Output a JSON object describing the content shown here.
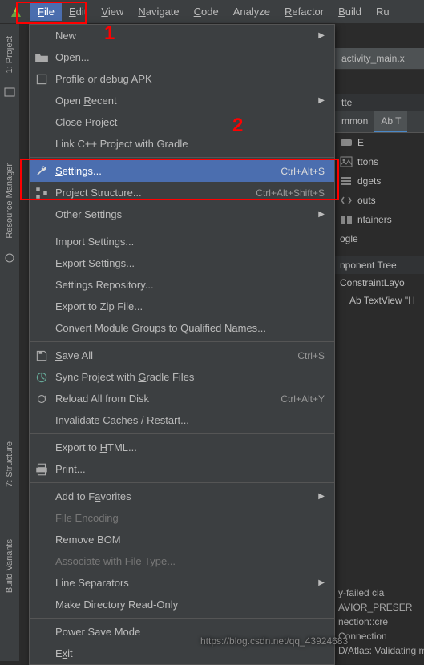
{
  "menubar": {
    "items": [
      {
        "label": "File",
        "mn": "F",
        "rest": "ile"
      },
      {
        "label": "Edit",
        "mn": "E",
        "rest": "dit"
      },
      {
        "label": "View",
        "mn": "V",
        "rest": "iew"
      },
      {
        "label": "Navigate",
        "mn": "N",
        "rest": "avigate"
      },
      {
        "label": "Code",
        "mn": "C",
        "rest": "ode"
      },
      {
        "label": "Analyze",
        "mn": "",
        "rest": "Analyze"
      },
      {
        "label": "Refactor",
        "mn": "R",
        "rest": "efactor"
      },
      {
        "label": "Build",
        "mn": "B",
        "rest": "uild"
      },
      {
        "label": "Run",
        "mn": "",
        "rest": "Ru"
      }
    ]
  },
  "annotations": {
    "one": "1",
    "two": "2"
  },
  "menu": {
    "new": "New",
    "open": "Open...",
    "profile": "Profile or debug APK",
    "open_recent_pre": "Open ",
    "open_recent_mn": "R",
    "open_recent_post": "ecent",
    "close_project_pre": "Close Pro",
    "close_project_mn": "j",
    "close_project_post": "ect",
    "link_cpp": "Link C++ Project with Gradle",
    "settings_mn": "S",
    "settings_post": "ettings...",
    "settings_sc": "Ctrl+Alt+S",
    "proj_struct": "Project Structure...",
    "proj_struct_sc": "Ctrl+Alt+Shift+S",
    "other_settings": "Other Settings",
    "import_settings": "Import Settings...",
    "export_settings_mn": "E",
    "export_settings_post": "xport Settings...",
    "settings_repo": "Settings Repository...",
    "export_zip": "Export to Zip File...",
    "convert_groups": "Convert Module Groups to Qualified Names...",
    "save_all_mn": "S",
    "save_all_post": "ave All",
    "save_all_sc": "Ctrl+S",
    "sync_pre": "Sync Project with ",
    "sync_mn": "G",
    "sync_post": "radle Files",
    "reload": "Reload All from Disk",
    "reload_sc": "Ctrl+Alt+Y",
    "invalidate": "Invalidate Caches / Restart...",
    "export_html_pre": "Export to ",
    "export_html_mn": "H",
    "export_html_post": "TML...",
    "print_mn": "P",
    "print_post": "rint...",
    "favorites_pre": "Add to F",
    "favorites_mn": "a",
    "favorites_post": "vorites",
    "file_encoding": "File Encoding",
    "remove_bom": "Remove BOM",
    "associate": "Associate with File Type...",
    "line_sep": "Line Separators",
    "make_ro": "Make Directory Read-Only",
    "power_save": "Power Save Mode",
    "exit_pre": "E",
    "exit_mn": "x",
    "exit_post": "it"
  },
  "sidebar": {
    "project_tab": "1: Project",
    "resource_tab": "Resource Manager",
    "structure_tab": "7: Structure",
    "build_tab": "Build Variants"
  },
  "right": {
    "editor_tab": "activity_main.x",
    "palette": "tte",
    "tab_common": "mmon",
    "tab_text": "Ab T",
    "item_btn": "E",
    "item_btns": "ttons",
    "item_widgets": "dgets",
    "item_layouts": "outs",
    "item_containers": "ntainers",
    "item_google": "ogle",
    "tree_header": "nponent Tree",
    "tree_root": "ConstraintLayo",
    "tree_child": "Ab TextView \"H"
  },
  "console": {
    "l1": "y-failed cla",
    "l2": "AVIOR_PRESER",
    "l3": "nection::cre",
    "l4": "Connection",
    "l5": "D/Atlas: Validating map..."
  },
  "watermark": "https://blog.csdn.net/qq_43924683"
}
